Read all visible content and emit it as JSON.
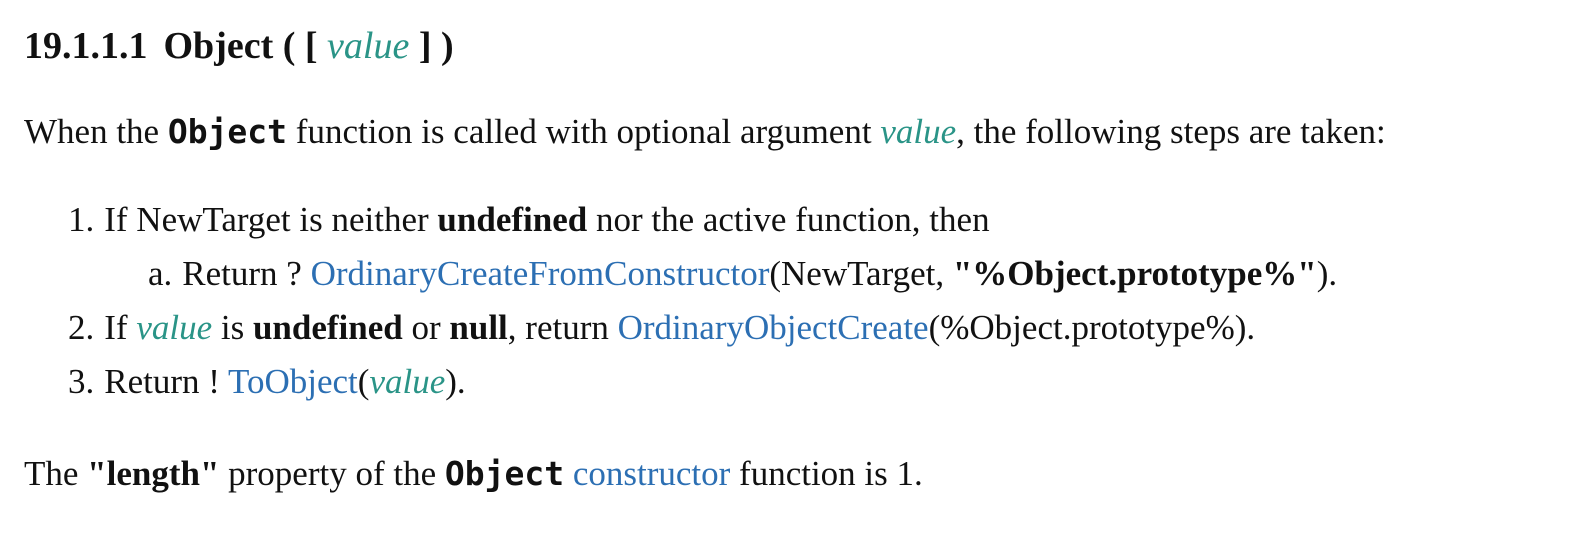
{
  "clause": {
    "number": "19.1.1.1",
    "title_name": "Object",
    "title_open": "( [",
    "title_param": "value",
    "title_close": "] )"
  },
  "intro": {
    "text1": "When the ",
    "code": "Object",
    "text2": " function is called with optional argument ",
    "var": "value",
    "text3": ", the following steps are taken:"
  },
  "steps": [
    {
      "marker": "1.",
      "t1": "If NewTarget is neither ",
      "b1": "undefined",
      "t2": " nor the active function, then"
    },
    {
      "marker": "a.",
      "t1": "Return ? ",
      "link": "OrdinaryCreateFromConstructor",
      "t2": "(NewTarget, ",
      "b1": "\"%Object.prototype%\"",
      "t3": ")."
    },
    {
      "marker": "2.",
      "t1": "If ",
      "var": "value",
      "t2": " is ",
      "b1": "undefined",
      "t3": " or ",
      "b2": "null",
      "t4": ", return ",
      "link": "OrdinaryObjectCreate",
      "t5": "(%Object.prototype%)."
    },
    {
      "marker": "3.",
      "t1": "Return ! ",
      "link": "ToObject",
      "t2": "(",
      "var": "value",
      "t3": ")."
    }
  ],
  "outro": {
    "t1": "The ",
    "b1": "\"length\"",
    "t2": " property of the ",
    "code": "Object",
    "t3": " ",
    "link": "constructor",
    "t4": " function is 1."
  },
  "colors": {
    "variable": "#2a9487",
    "link": "#2c6fb3",
    "text": "#111111"
  }
}
